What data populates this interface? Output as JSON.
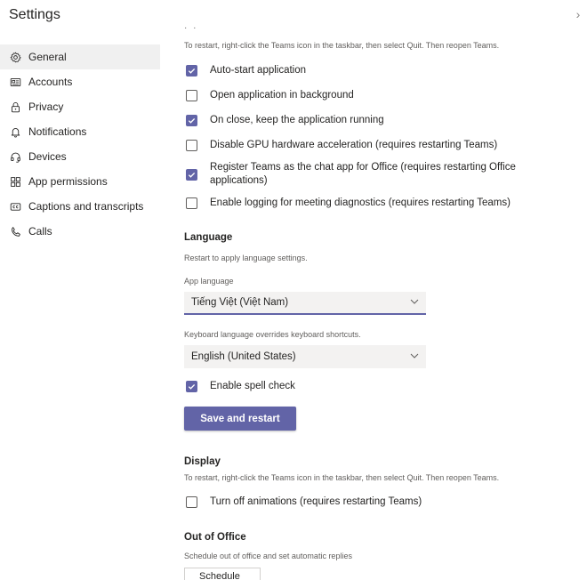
{
  "header": {
    "title": "Settings",
    "close_glyph": "›"
  },
  "sidebar": {
    "items": [
      {
        "label": "General",
        "icon": "gear-icon",
        "active": true
      },
      {
        "label": "Accounts",
        "icon": "id-card-icon"
      },
      {
        "label": "Privacy",
        "icon": "lock-icon"
      },
      {
        "label": "Notifications",
        "icon": "bell-icon"
      },
      {
        "label": "Devices",
        "icon": "headset-icon"
      },
      {
        "label": "App permissions",
        "icon": "apps-icon"
      },
      {
        "label": "Captions and transcripts",
        "icon": "cc-icon"
      },
      {
        "label": "Calls",
        "icon": "phone-icon"
      }
    ]
  },
  "application": {
    "dots": "· ·",
    "restart_note": "To restart, right-click the Teams icon in the taskbar, then select Quit. Then reopen Teams.",
    "options": [
      {
        "label": "Auto-start application",
        "checked": true
      },
      {
        "label": "Open application in background",
        "checked": false
      },
      {
        "label": "On close, keep the application running",
        "checked": true
      },
      {
        "label": "Disable GPU hardware acceleration (requires restarting Teams)",
        "checked": false
      },
      {
        "label": "Register Teams as the chat app for Office (requires restarting Office applications)",
        "checked": true
      },
      {
        "label": "Enable logging for meeting diagnostics (requires restarting Teams)",
        "checked": false
      }
    ]
  },
  "language": {
    "title": "Language",
    "note": "Restart to apply language settings.",
    "app_language_label": "App language",
    "app_language_value": "Tiếng Việt (Việt Nam)",
    "keyboard_note": "Keyboard language overrides keyboard shortcuts.",
    "keyboard_language_value": "English (United States)",
    "spell_check_label": "Enable spell check",
    "spell_check_checked": true,
    "save_button": "Save and restart"
  },
  "display": {
    "title": "Display",
    "note": "To restart, right-click the Teams icon in the taskbar, then select Quit. Then reopen Teams.",
    "animations_label": "Turn off animations (requires restarting Teams)",
    "animations_checked": false
  },
  "out_of_office": {
    "title": "Out of Office",
    "note": "Schedule out of office and set automatic replies",
    "button": "Schedule"
  },
  "colors": {
    "accent": "#6264a7",
    "text": "#252423",
    "subtle": "#605e5c",
    "field_bg": "#f3f2f1"
  }
}
